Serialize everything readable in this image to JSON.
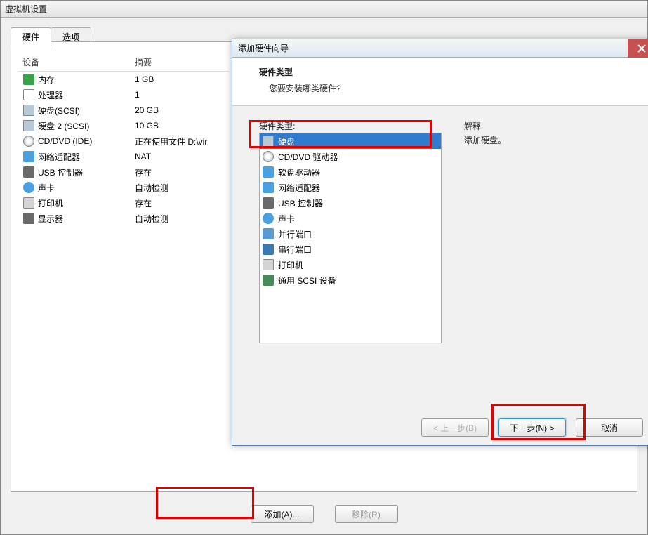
{
  "settings": {
    "title": "虚拟机设置",
    "tabs": {
      "hardware": "硬件",
      "options": "选项"
    },
    "headers": {
      "device": "设备",
      "summary": "摘要"
    },
    "devices": [
      {
        "name": "内存",
        "summary": "1 GB",
        "icon": "memory"
      },
      {
        "name": "处理器",
        "summary": "1",
        "icon": "cpu"
      },
      {
        "name": "硬盘(SCSI)",
        "summary": "20 GB",
        "icon": "hdd"
      },
      {
        "name": "硬盘 2 (SCSI)",
        "summary": "10 GB",
        "icon": "hdd"
      },
      {
        "name": "CD/DVD (IDE)",
        "summary": "正在使用文件 D:\\vir",
        "icon": "cd"
      },
      {
        "name": "网络适配器",
        "summary": "NAT",
        "icon": "net"
      },
      {
        "name": "USB 控制器",
        "summary": "存在",
        "icon": "usb"
      },
      {
        "name": "声卡",
        "summary": "自动检测",
        "icon": "sound"
      },
      {
        "name": "打印机",
        "summary": "存在",
        "icon": "printer"
      },
      {
        "name": "显示器",
        "summary": "自动检测",
        "icon": "display"
      }
    ],
    "buttons": {
      "add": "添加(A)...",
      "remove": "移除(R)"
    }
  },
  "wizard": {
    "title": "添加硬件向导",
    "header": {
      "t1": "硬件类型",
      "t2": "您要安装哪类硬件?"
    },
    "hw_label": "硬件类型:",
    "explain_label": "解释",
    "explain_body": "添加硬盘。",
    "items": [
      {
        "label": "硬盘",
        "icon": "hdd",
        "selected": true
      },
      {
        "label": "CD/DVD 驱动器",
        "icon": "cd"
      },
      {
        "label": "软盘驱动器",
        "icon": "fdd"
      },
      {
        "label": "网络适配器",
        "icon": "net"
      },
      {
        "label": "USB 控制器",
        "icon": "usb"
      },
      {
        "label": "声卡",
        "icon": "sound"
      },
      {
        "label": "并行端口",
        "icon": "par"
      },
      {
        "label": "串行端口",
        "icon": "ser"
      },
      {
        "label": "打印机",
        "icon": "printer"
      },
      {
        "label": "通用 SCSI 设备",
        "icon": "scsi"
      }
    ],
    "buttons": {
      "back": "< 上一步(B)",
      "next": "下一步(N) >",
      "cancel": "取消"
    }
  }
}
